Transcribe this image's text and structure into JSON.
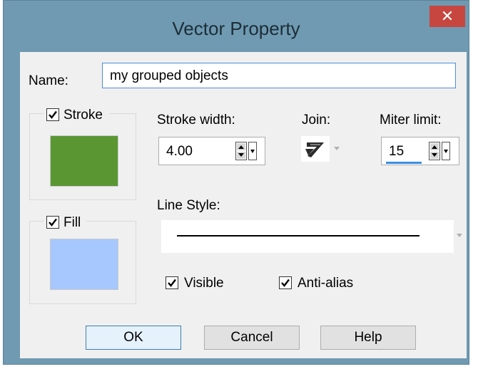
{
  "dialog": {
    "title": "Vector Property",
    "close_glyph": "✕"
  },
  "name": {
    "label": "Name:",
    "value": "my grouped objects"
  },
  "stroke": {
    "label": "Stroke",
    "checked": true,
    "color": "#5a9632",
    "width_label": "Stroke width:",
    "width_value": "4.00"
  },
  "join": {
    "label": "Join:",
    "icon": "miter-join-icon"
  },
  "miter": {
    "label": "Miter limit:",
    "value": "15"
  },
  "fill": {
    "label": "Fill",
    "checked": true,
    "color": "#a6c8ff"
  },
  "line_style": {
    "label": "Line Style:"
  },
  "options": {
    "visible_label": "Visible",
    "antialias_label": "Anti-alias"
  },
  "buttons": {
    "ok": "OK",
    "cancel": "Cancel",
    "help": "Help"
  }
}
